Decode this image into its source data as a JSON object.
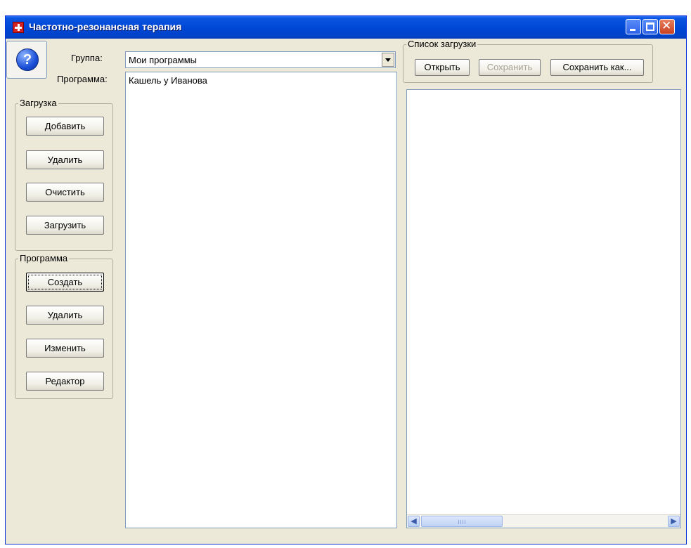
{
  "window": {
    "title": "Частотно-резонансная терапия",
    "help_glyph": "?"
  },
  "filters": {
    "group_label": "Группа:",
    "group_value": "Мои программы",
    "program_label": "Программа:"
  },
  "programs": {
    "items": [
      "Кашель у Иванова"
    ]
  },
  "load_group": {
    "title": "Загрузка",
    "buttons": [
      "Добавить",
      "Удалить",
      "Очистить",
      "Загрузить"
    ]
  },
  "program_group": {
    "title": "Программа",
    "buttons": [
      "Создать",
      "Удалить",
      "Изменить",
      "Редактор"
    ]
  },
  "load_list": {
    "title": "Список загрузки",
    "open_label": "Открыть",
    "save_label": "Сохранить",
    "save_as_label": "Сохранить как..."
  },
  "icons": {
    "app": "red-cross-icon",
    "help": "help-icon",
    "minimize": "minimize-icon",
    "maximize": "maximize-icon",
    "close": "close-icon",
    "dropdown": "chevron-down-icon",
    "scroll_left": "scroll-left-icon",
    "scroll_right": "scroll-right-icon"
  },
  "colors": {
    "titlebar": "#0047d6",
    "window_bg": "#ece9d8",
    "border": "#7f9db9",
    "disabled_text": "#a6a394"
  }
}
